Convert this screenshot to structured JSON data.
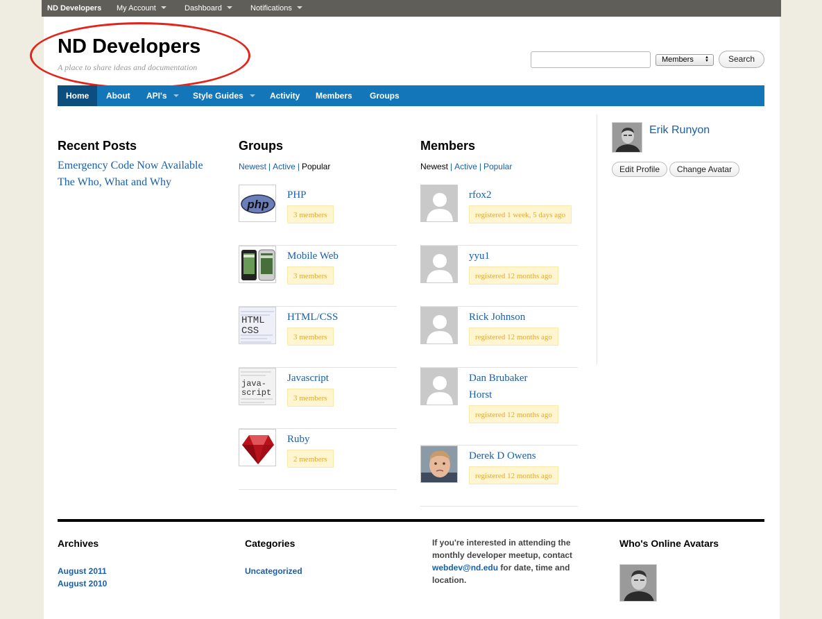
{
  "adminbar": {
    "brand": "ND Developers",
    "menus": [
      {
        "label": "My Account"
      },
      {
        "label": "Dashboard"
      },
      {
        "label": "Notifications"
      }
    ]
  },
  "header": {
    "title": "ND Developers",
    "tagline": "A place to share ideas and documentation",
    "search": {
      "value": "",
      "select_value": "Members",
      "button_label": "Search"
    }
  },
  "nav": {
    "items": [
      {
        "label": "Home",
        "active": true
      },
      {
        "label": "About"
      },
      {
        "label": "API's",
        "has_menu": true
      },
      {
        "label": "Style Guides",
        "has_menu": true
      },
      {
        "label": "Activity"
      },
      {
        "label": "Members"
      },
      {
        "label": "Groups"
      }
    ]
  },
  "recent_posts": {
    "heading": "Recent Posts",
    "posts": [
      "Emergency Code Now Available",
      "The Who, What and Why"
    ]
  },
  "groups": {
    "heading": "Groups",
    "filters": [
      "Newest",
      "Active",
      "Popular"
    ],
    "selected_filter": "Popular",
    "items": [
      {
        "name": "PHP",
        "members": "3 members",
        "icon": "php-logo"
      },
      {
        "name": "Mobile Web",
        "members": "3 members",
        "icon": "smartphones"
      },
      {
        "name": "HTML/CSS",
        "members": "3 members",
        "icon": "html-css-code"
      },
      {
        "name": "Javascript",
        "members": "3 members",
        "icon": "javascript-code"
      },
      {
        "name": "Ruby",
        "members": "2 members",
        "icon": "ruby-gem"
      }
    ]
  },
  "members": {
    "heading": "Members",
    "filters": [
      "Newest",
      "Active",
      "Popular"
    ],
    "selected_filter": "Newest",
    "items": [
      {
        "name": "rfox2",
        "registered": "registered 1 week, 5 days ago"
      },
      {
        "name": "yyu1",
        "registered": "registered 12 months ago"
      },
      {
        "name": "Rick Johnson",
        "registered": "registered 12 months ago"
      },
      {
        "name_line1": "Dan Brubaker",
        "name_line2": "Horst",
        "registered": "registered 12 months ago"
      },
      {
        "name": "Derek D Owens",
        "registered": "registered 12 months ago"
      }
    ]
  },
  "profile": {
    "name": "Erik Runyon",
    "edit_label": "Edit Profile",
    "avatar_label": "Change Avatar"
  },
  "footer": {
    "archives": {
      "heading": "Archives",
      "links": [
        "August 2011",
        "August 2010"
      ]
    },
    "categories": {
      "heading": "Categories",
      "links": [
        "Uncategorized"
      ]
    },
    "meetup": {
      "text_before": "If you're interested in attending the monthly developer meetup, contact ",
      "email": "webdev@nd.edu",
      "text_after": " for date, time and location."
    },
    "online": {
      "heading": "Who's Online Avatars"
    }
  },
  "colors": {
    "nav_blue": "#1276b8",
    "nav_active": "#0c4f7f",
    "link": "#1a5ea6",
    "badge_bg": "#fff6d1",
    "badge_text": "#e0a83a",
    "highlight_circle": "#e2241b",
    "adminbar": "#5f5e58",
    "page_bg": "#efece1"
  }
}
